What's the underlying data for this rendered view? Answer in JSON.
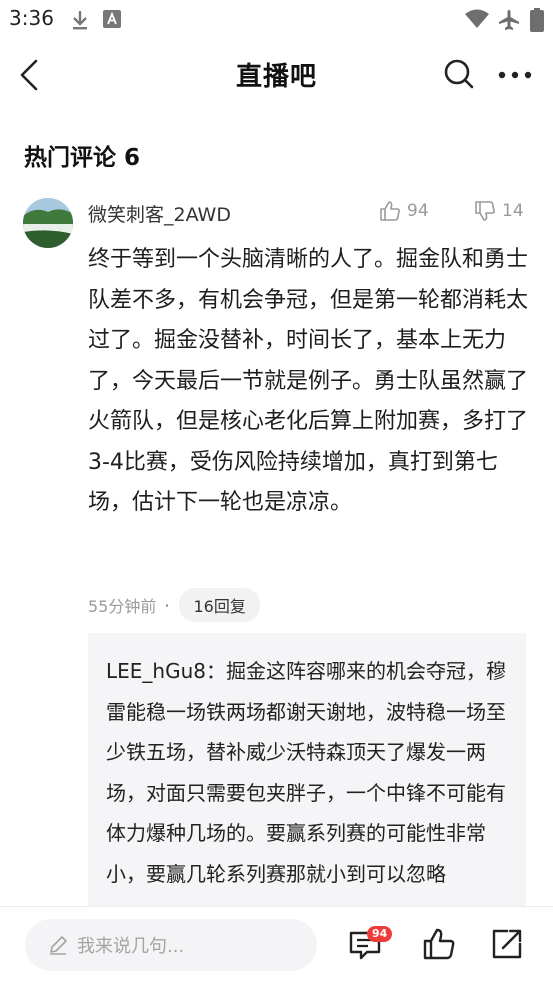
{
  "status_bar": {
    "time": "3:36",
    "icons": [
      "download-icon",
      "font-app-icon",
      "wifi-icon",
      "airplane-mode-icon",
      "battery-icon"
    ]
  },
  "nav": {
    "title": "直播吧",
    "back_icon": "back-arrow-icon",
    "search_icon": "search-icon",
    "more_icon": "more-options-icon"
  },
  "section": {
    "title": "热门评论 6"
  },
  "comment": {
    "username": "微笑刺客_2AWD",
    "likes": "94",
    "dislikes": "14",
    "body": "终于等到一个头脑清晰的人了。掘金队和勇士队差不多，有机会争冠，但是第一轮都消耗太过了。掘金没替补，时间长了，基本上无力了，今天最后一节就是例子。勇士队虽然赢了火箭队，但是核心老化后算上附加赛，多打了3-4比赛，受伤风险持续增加，真打到第七场，估计下一轮也是凉凉。",
    "time": "55分钟前",
    "separator": "·",
    "replies": "16回复"
  },
  "reply": {
    "author": "LEE_hGu8",
    "text": "：掘金这阵容哪来的机会夺冠，穆雷能稳一场铁两场都谢天谢地，波特稳一场至少铁五场，替补威少沃特森顶天了爆发一两场，对面只需要包夹胖子，一个中锋不可能有体力爆种几场的。要赢系列赛的可能性非常小，要赢几轮系列赛那就小到可以忽略"
  },
  "bottom_bar": {
    "input_placeholder": "我来说几句...",
    "comment_count": "94",
    "icons": [
      "edit-pencil-icon",
      "comments-icon",
      "like-icon",
      "share-icon"
    ]
  },
  "colors": {
    "badge": "#f03b3b",
    "muted_text": "#9b9b9b",
    "reply_background": "#f5f5f7"
  }
}
